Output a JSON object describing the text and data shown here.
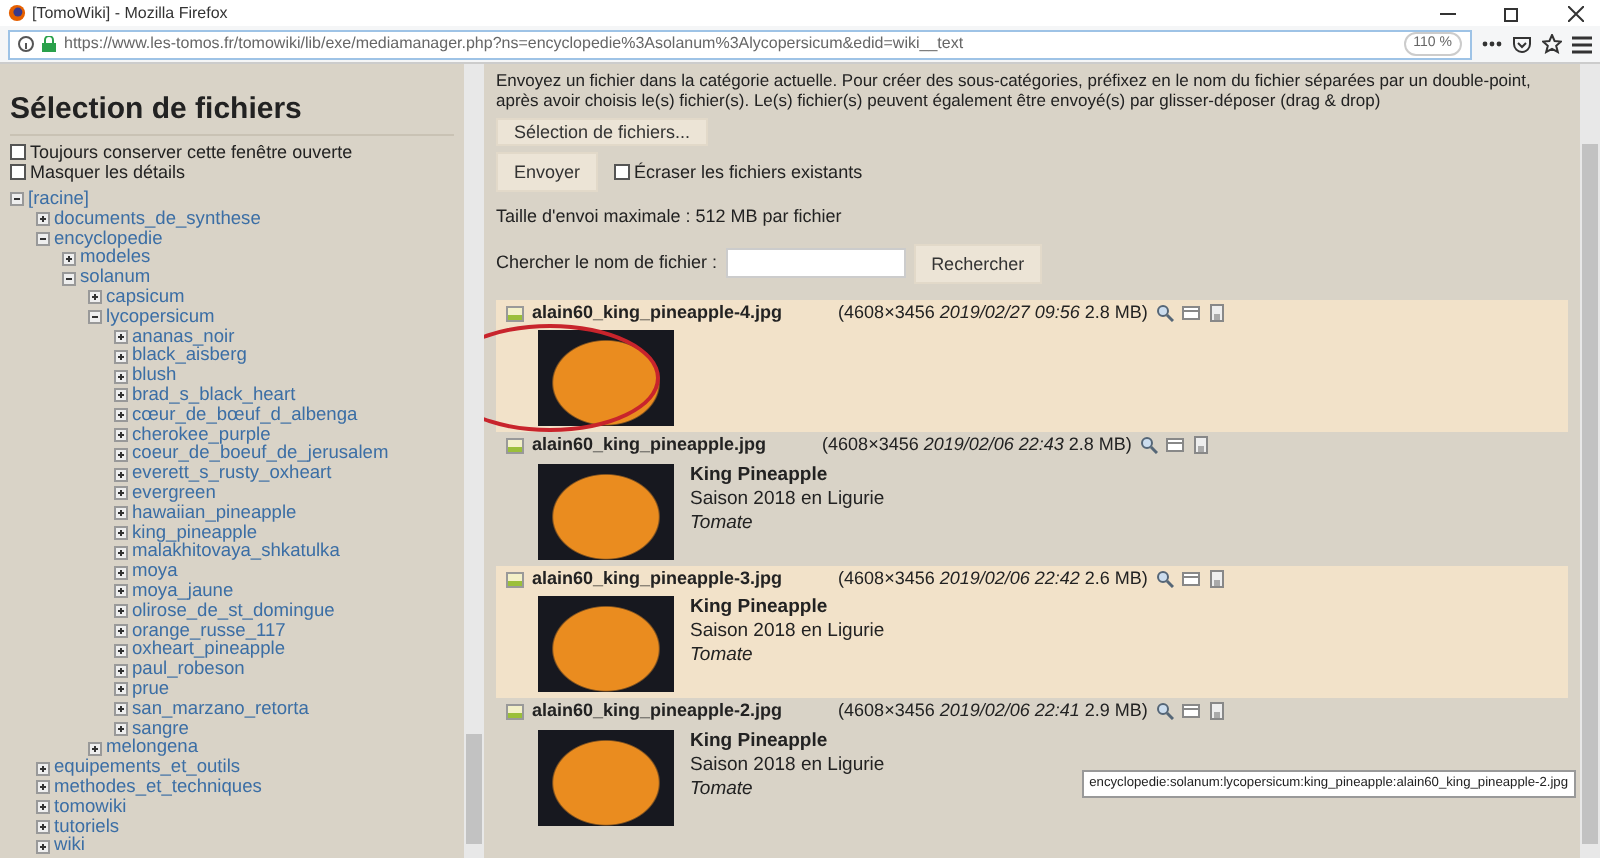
{
  "window": {
    "title": "[TomoWiki] - Mozilla Firefox"
  },
  "address_bar": {
    "url": "https://www.les-tomos.fr/tomowiki/lib/exe/mediamanager.php?ns=encyclopedie%3Asolanum%3Alycopersicum&edid=wiki__text",
    "zoom": "110 %"
  },
  "sidebar": {
    "title": "Sélection de fichiers",
    "options": [
      {
        "label": "Toujours conserver cette fenêtre ouverte",
        "checked": false
      },
      {
        "label": "Masquer les détails",
        "checked": false
      }
    ],
    "tree": [
      {
        "label": "[racine]",
        "expanded": true,
        "children": [
          {
            "label": "documents_de_synthese",
            "expanded": false
          },
          {
            "label": "encyclopedie",
            "expanded": true,
            "children": [
              {
                "label": "modeles",
                "expanded": false
              },
              {
                "label": "solanum",
                "expanded": true,
                "children": [
                  {
                    "label": "capsicum",
                    "expanded": false
                  },
                  {
                    "label": "lycopersicum",
                    "expanded": true,
                    "children": [
                      {
                        "label": "ananas_noir",
                        "expanded": false
                      },
                      {
                        "label": "black_aisberg",
                        "expanded": false
                      },
                      {
                        "label": "blush",
                        "expanded": false
                      },
                      {
                        "label": "brad_s_black_heart",
                        "expanded": false
                      },
                      {
                        "label": "cœur_de_bœuf_d_albenga",
                        "expanded": false
                      },
                      {
                        "label": "cherokee_purple",
                        "expanded": false
                      },
                      {
                        "label": "coeur_de_boeuf_de_jerusalem",
                        "expanded": false
                      },
                      {
                        "label": "everett_s_rusty_oxheart",
                        "expanded": false
                      },
                      {
                        "label": "evergreen",
                        "expanded": false
                      },
                      {
                        "label": "hawaiian_pineapple",
                        "expanded": false
                      },
                      {
                        "label": "king_pineapple",
                        "expanded": false
                      },
                      {
                        "label": "malakhitovaya_shkatulka",
                        "expanded": false
                      },
                      {
                        "label": "moya",
                        "expanded": false
                      },
                      {
                        "label": "moya_jaune",
                        "expanded": false
                      },
                      {
                        "label": "olirose_de_st_domingue",
                        "expanded": false
                      },
                      {
                        "label": "orange_russe_117",
                        "expanded": false
                      },
                      {
                        "label": "oxheart_pineapple",
                        "expanded": false
                      },
                      {
                        "label": "paul_robeson",
                        "expanded": false
                      },
                      {
                        "label": "prue",
                        "expanded": false
                      },
                      {
                        "label": "san_marzano_retorta",
                        "expanded": false
                      },
                      {
                        "label": "sangre",
                        "expanded": false
                      }
                    ]
                  },
                  {
                    "label": "melongena",
                    "expanded": false
                  }
                ]
              }
            ]
          },
          {
            "label": "equipements_et_outils",
            "expanded": false
          },
          {
            "label": "methodes_et_techniques",
            "expanded": false
          },
          {
            "label": "tomowiki",
            "expanded": false
          },
          {
            "label": "tutoriels",
            "expanded": false
          },
          {
            "label": "wiki",
            "expanded": false
          }
        ]
      }
    ]
  },
  "upload": {
    "intro": "Envoyez un fichier dans la catégorie actuelle. Pour créer des sous-catégories, préfixez en le nom du fichier séparées par un double-point, après avoir choisis le(s) fichier(s). Le(s) fichier(s) peuvent également être envoyé(s) par glisser-déposer (drag & drop)",
    "select_button": "Sélection de fichiers...",
    "send_button": "Envoyer",
    "overwrite": {
      "label": "Écraser les fichiers existants",
      "checked": false
    },
    "max_size": "Taille d'envoi maximale : 512 MB par fichier"
  },
  "search": {
    "label": "Chercher le nom de fichier :",
    "button": "Rechercher"
  },
  "files": [
    {
      "name": "alain60_king_pineapple-4.jpg",
      "info": "(4608×3456 *2019/02/27 09:56* 2.8 MB)"
    },
    {
      "name": "alain60_king_pineapple.jpg",
      "info": "(4608×3456 *2019/02/06 22:43* 2.8 MB)",
      "title": "King Pineapple",
      "description": "Saison 2018 en Ligurie",
      "category": "Tomate"
    },
    {
      "name": "alain60_king_pineapple-3.jpg",
      "info": "(4608×3456 *2019/02/06 22:42* 2.6 MB)",
      "title": "King Pineapple",
      "description": "Saison 2018 en Ligurie",
      "category": "Tomate"
    },
    {
      "name": "alain60_king_pineapple-2.jpg",
      "info": "(4608×3456 *2019/02/06 22:41* 2.9 MB)",
      "title": "King Pineapple",
      "description": "Saison 2018 en Ligurie",
      "category": "Tomate"
    }
  ],
  "tooltip": "encyclopedie:solanum:lycopersicum:king_pineapple:alain60_king_pineapple-2.jpg"
}
